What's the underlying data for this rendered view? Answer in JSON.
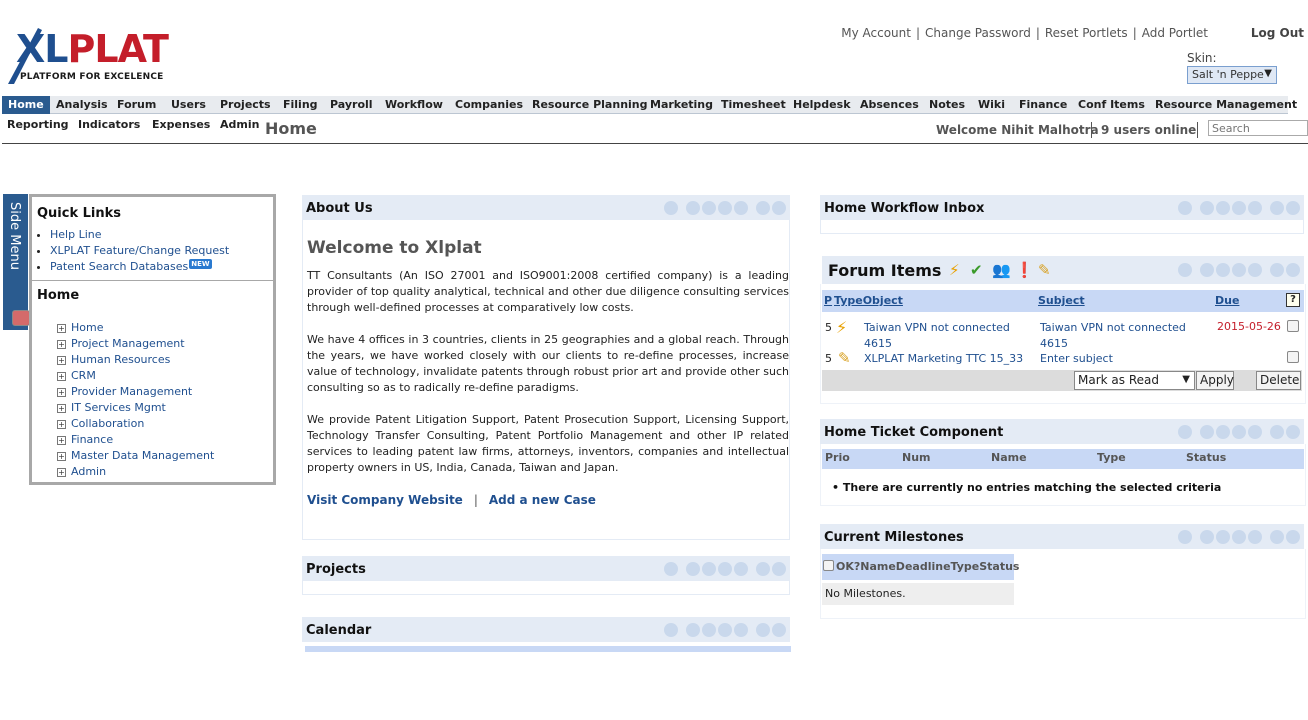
{
  "logo": {
    "text_a": "XL",
    "text_b": "PLAT",
    "tagline": "PLATFORM FOR EXCELENCE"
  },
  "toplinks": [
    "My Account",
    "Change Password",
    "Reset Portlets",
    "Add Portlet"
  ],
  "logout": "Log Out",
  "skin": {
    "label": "Skin:",
    "value": "Salt 'n Peppe"
  },
  "nav": {
    "row1": [
      "Home",
      "Analysis",
      "Forum",
      "Users",
      "Projects",
      "Filing",
      "Payroll",
      "Workflow",
      "Companies",
      "Resource Planning",
      "Marketing",
      "Timesheet",
      "Helpdesk",
      "Absences",
      "Notes",
      "Wiki",
      "Finance",
      "Conf Items",
      "Resource Management"
    ],
    "row2": [
      "Reporting",
      "Indicators",
      "Expenses",
      "Admin"
    ]
  },
  "page_title": "Home",
  "welcome": "Welcome Nihit Malhotra",
  "online": "9 users online",
  "search_placeholder": "Search",
  "side_menu": "Side Menu",
  "quick_links": {
    "title": "Quick Links",
    "items": [
      "Help Line",
      "XLPLAT Feature/Change Request",
      "Patent Search Databases"
    ],
    "new_badge": "NEW",
    "home_title": "Home",
    "tree": [
      "Home",
      "Project Management",
      "Human Resources",
      "CRM",
      "Provider Management",
      "IT Services Mgmt",
      "Collaboration",
      "Finance",
      "Master Data Management",
      "Admin"
    ]
  },
  "about": {
    "title": "About Us",
    "heading": "Welcome to Xlplat",
    "p1": "TT Consultants (An ISO 27001 and ISO9001:2008 certified company) is a leading provider of top quality analytical, technical and other due diligence consulting services through well-defined processes at comparatively low costs.",
    "p2": "We have 4 offices in 3 countries, clients in 25 geographies and a global reach. Through the years, we have worked closely with our clients to re-define processes, increase value of technology, invalidate patents through robust prior art and provide other such consulting so as to radically re-define paradigms.",
    "p3": "We provide Patent Litigation Support, Patent Prosecution Support, Licensing Support, Technology Transfer Consulting, Patent Portfolio Management and other IP related services to leading patent law firms, attorneys, inventors, companies and intellectual property owners in US, India, Canada, Taiwan and Japan.",
    "link1": "Visit Company Website",
    "sep": "|",
    "link2": "Add a new Case"
  },
  "projects_title": "Projects",
  "calendar_title": "Calendar",
  "workflow_title": "Home Workflow Inbox",
  "forum": {
    "title": "Forum Items",
    "cols": {
      "p": "P",
      "type_object": "TypeObject",
      "subject": "Subject",
      "due": "Due",
      "help": "?"
    },
    "rows": [
      {
        "p": "5",
        "icon": "lightning-icon",
        "object": "Taiwan VPN not connected 4615",
        "subject": "Taiwan VPN not connected 4615",
        "due": "2015-05-26"
      },
      {
        "p": "5",
        "icon": "pencil-icon",
        "object": "XLPLAT Marketing TTC 15_33",
        "subject": "Enter subject",
        "due": ""
      }
    ],
    "action_select": "Mark as Read",
    "apply": "Apply",
    "delete": "Delete"
  },
  "ticket": {
    "title": "Home Ticket Component",
    "cols": [
      "Prio",
      "Num",
      "Name",
      "Type",
      "Status"
    ],
    "empty": "There are currently no entries matching the selected criteria"
  },
  "milestones": {
    "title": "Current Milestones",
    "header": "OK?NameDeadlineTypeStatus",
    "empty": "No Milestones."
  },
  "colors": {
    "nav_active": "#2a5b8f",
    "portlet_head": "#e4ebf5",
    "table_head": "#c8d8f5",
    "due": "#c41e2a"
  }
}
